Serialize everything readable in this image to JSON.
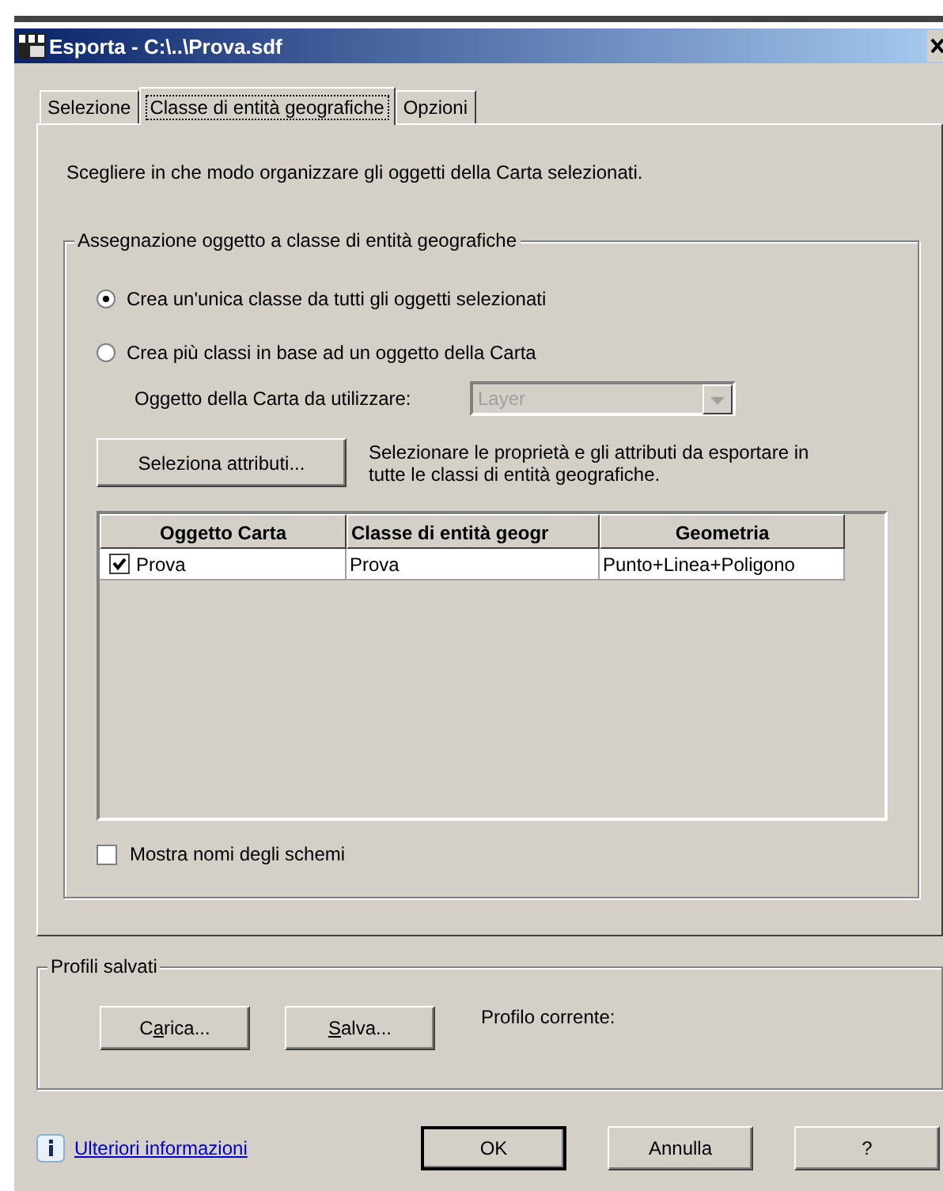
{
  "window": {
    "title": "Esporta - C:\\..\\Prova.sdf"
  },
  "tabs": [
    {
      "label": "Selezione",
      "selected": false
    },
    {
      "label": "Classe di entità geografiche",
      "selected": true
    },
    {
      "label": "Opzioni",
      "selected": false
    }
  ],
  "intro": "Scegliere in che modo organizzare gli oggetti della Carta selezionati.",
  "assignment_group": {
    "title": "Assegnazione oggetto a classe di entità geografiche",
    "options": [
      {
        "label": "Crea un'unica classe da tutti gli oggetti selezionati",
        "selected": true
      },
      {
        "label": "Crea più classi in base ad un oggetto della Carta",
        "selected": false
      }
    ],
    "map_object": {
      "label": "Oggetto della Carta da utilizzare:",
      "value": "Layer",
      "disabled": true
    },
    "attributes_button": "Seleziona attributi...",
    "attributes_hint": "Selezionare le proprietà e gli attributi da esportare in tutte le classi di entità geografiche.",
    "table": {
      "columns": [
        "Oggetto Carta",
        "Classe di entità geogr",
        "Geometria"
      ],
      "rows": [
        {
          "checked": true,
          "cells": [
            "Prova",
            "Prova",
            "Punto+Linea+Poligono"
          ]
        }
      ]
    },
    "show_schema_names": {
      "label": "Mostra nomi degli schemi",
      "checked": false
    }
  },
  "saved_profiles": {
    "title": "Profili salvati",
    "buttons": [
      {
        "label_before": "C",
        "access_key": "a",
        "label_after": "rica..."
      },
      {
        "access_key": "S",
        "label_after": "alva..."
      }
    ],
    "current_label": "Profilo corrente:"
  },
  "footer": {
    "link": "Ulteriori informazioni",
    "buttons": [
      {
        "label": "OK",
        "default": true
      },
      {
        "label": "Annulla",
        "default": false
      },
      {
        "label": "?",
        "default": false
      }
    ]
  }
}
